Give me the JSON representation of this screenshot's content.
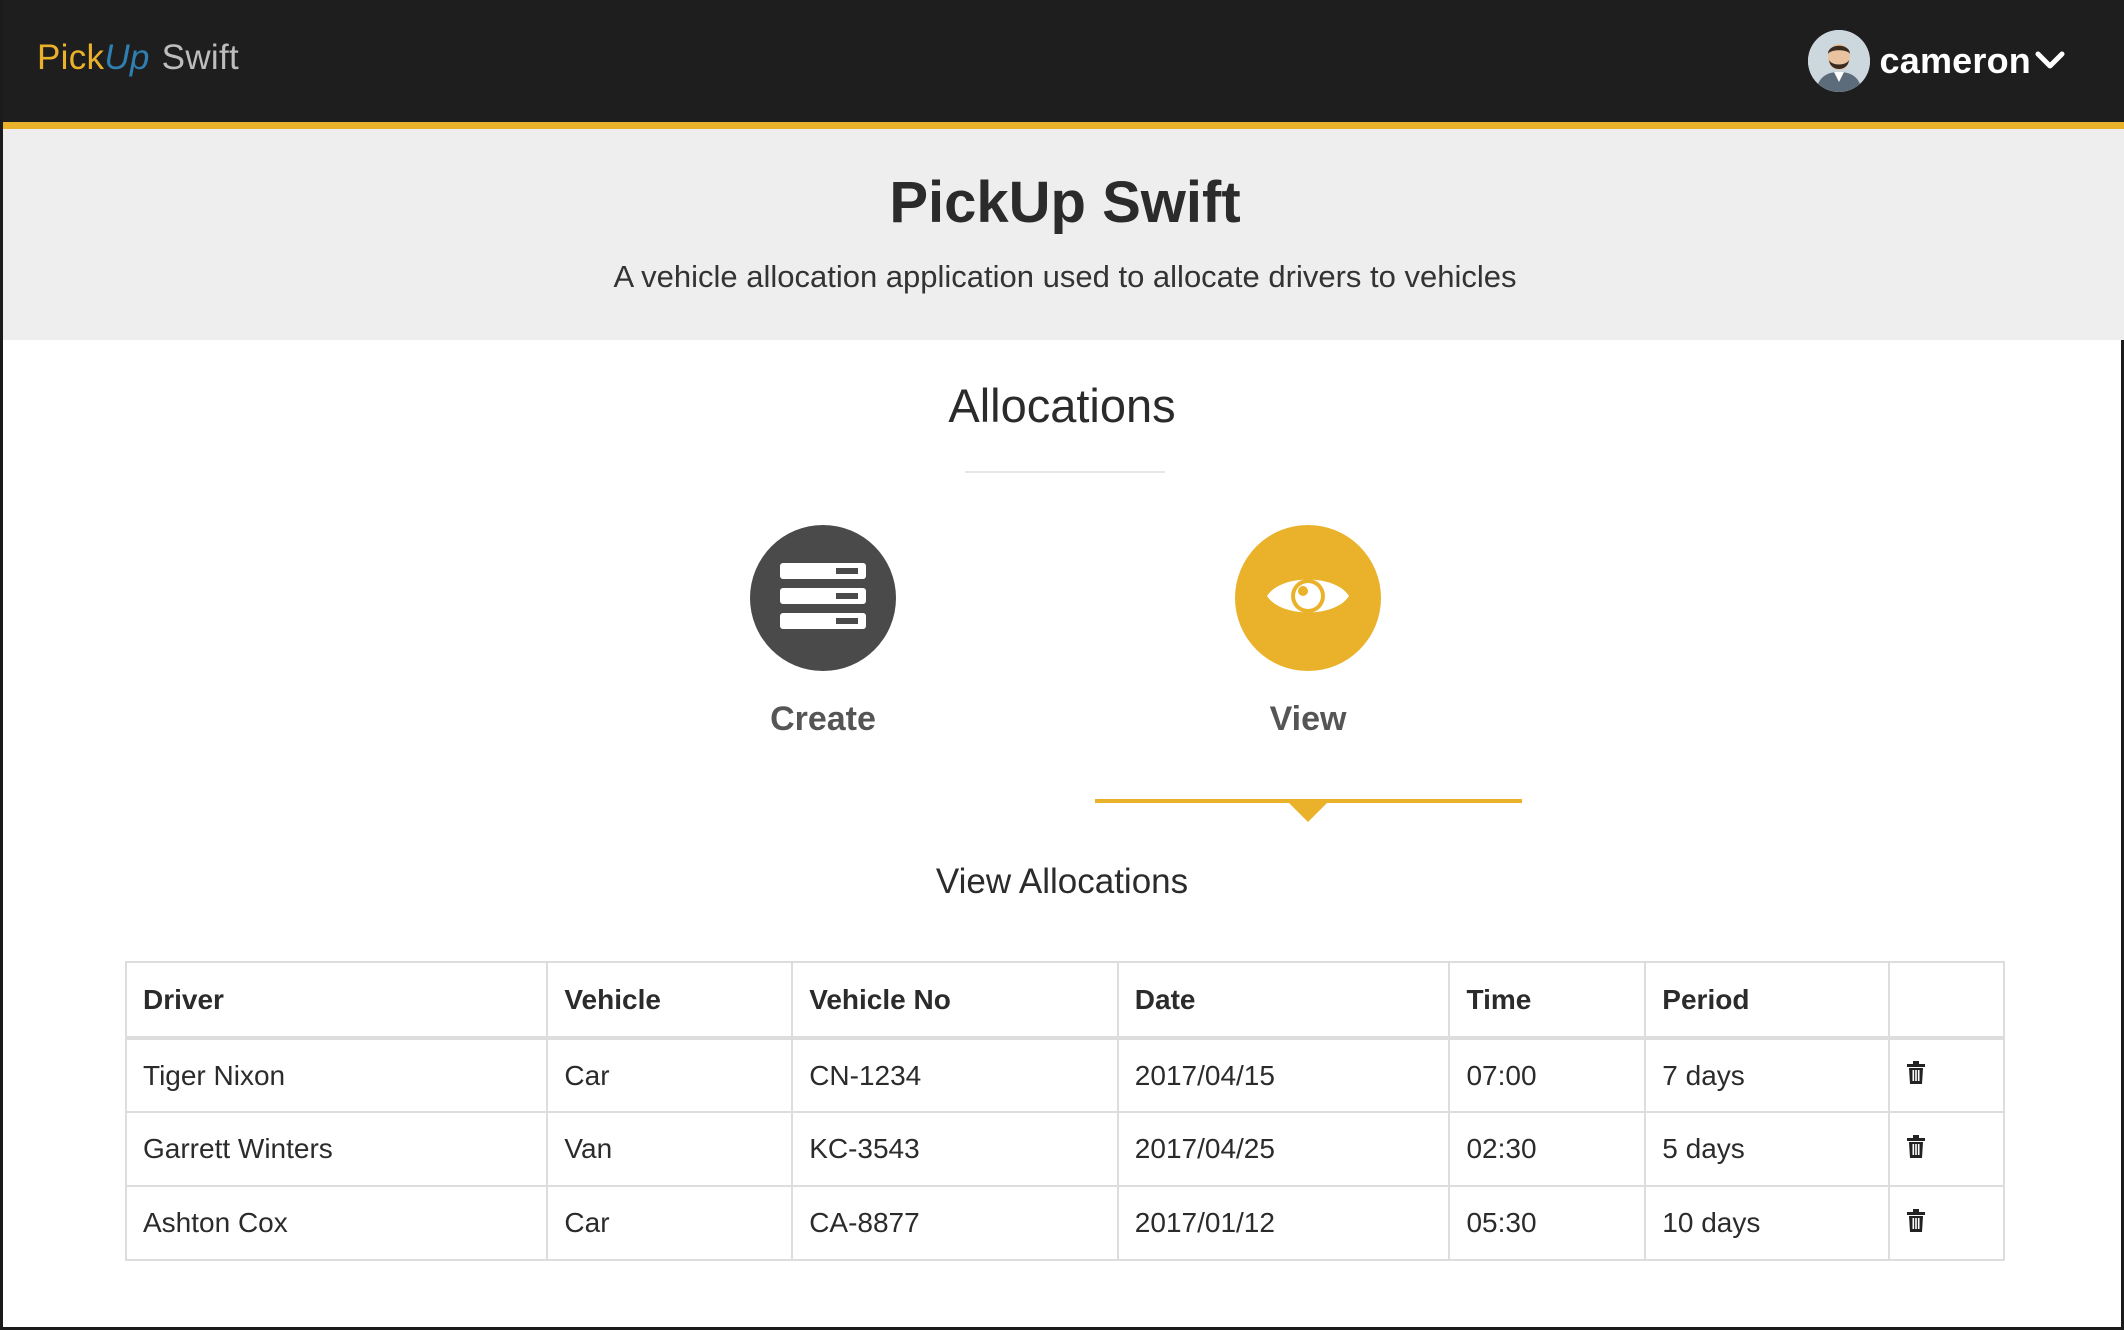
{
  "navbar": {
    "brand_pick": "Pick",
    "brand_up": "Up",
    "brand_swift": "Swift",
    "user_name": "cameron"
  },
  "hero": {
    "title": "PickUp Swift",
    "subtitle": "A vehicle allocation application used to allocate drivers to vehicles"
  },
  "section": {
    "title": "Allocations",
    "actions": [
      {
        "label": "Create",
        "icon": "server-list-icon",
        "active": false
      },
      {
        "label": "View",
        "icon": "eye-icon",
        "active": true
      }
    ],
    "subsection_title": "View Allocations"
  },
  "table": {
    "headers": [
      "Driver",
      "Vehicle",
      "Vehicle No",
      "Date",
      "Time",
      "Period",
      ""
    ],
    "rows": [
      {
        "driver": "Tiger Nixon",
        "vehicle": "Car",
        "vehicle_no": "CN-1234",
        "date": "2017/04/15",
        "time": "07:00",
        "period": "7 days"
      },
      {
        "driver": "Garrett Winters",
        "vehicle": "Van",
        "vehicle_no": "KC-3543",
        "date": "2017/04/25",
        "time": "02:30",
        "period": "5 days"
      },
      {
        "driver": "Ashton Cox",
        "vehicle": "Car",
        "vehicle_no": "CA-8877",
        "date": "2017/01/12",
        "time": "05:30",
        "period": "10 days"
      }
    ],
    "row_action_icon": "trash-icon"
  },
  "colors": {
    "navbar_bg": "#1e1e1e",
    "accent": "#e9b22a",
    "brand_blue": "#2f7fb0",
    "hero_bg": "#eeeeee",
    "create_circle": "#4a4a4a"
  }
}
